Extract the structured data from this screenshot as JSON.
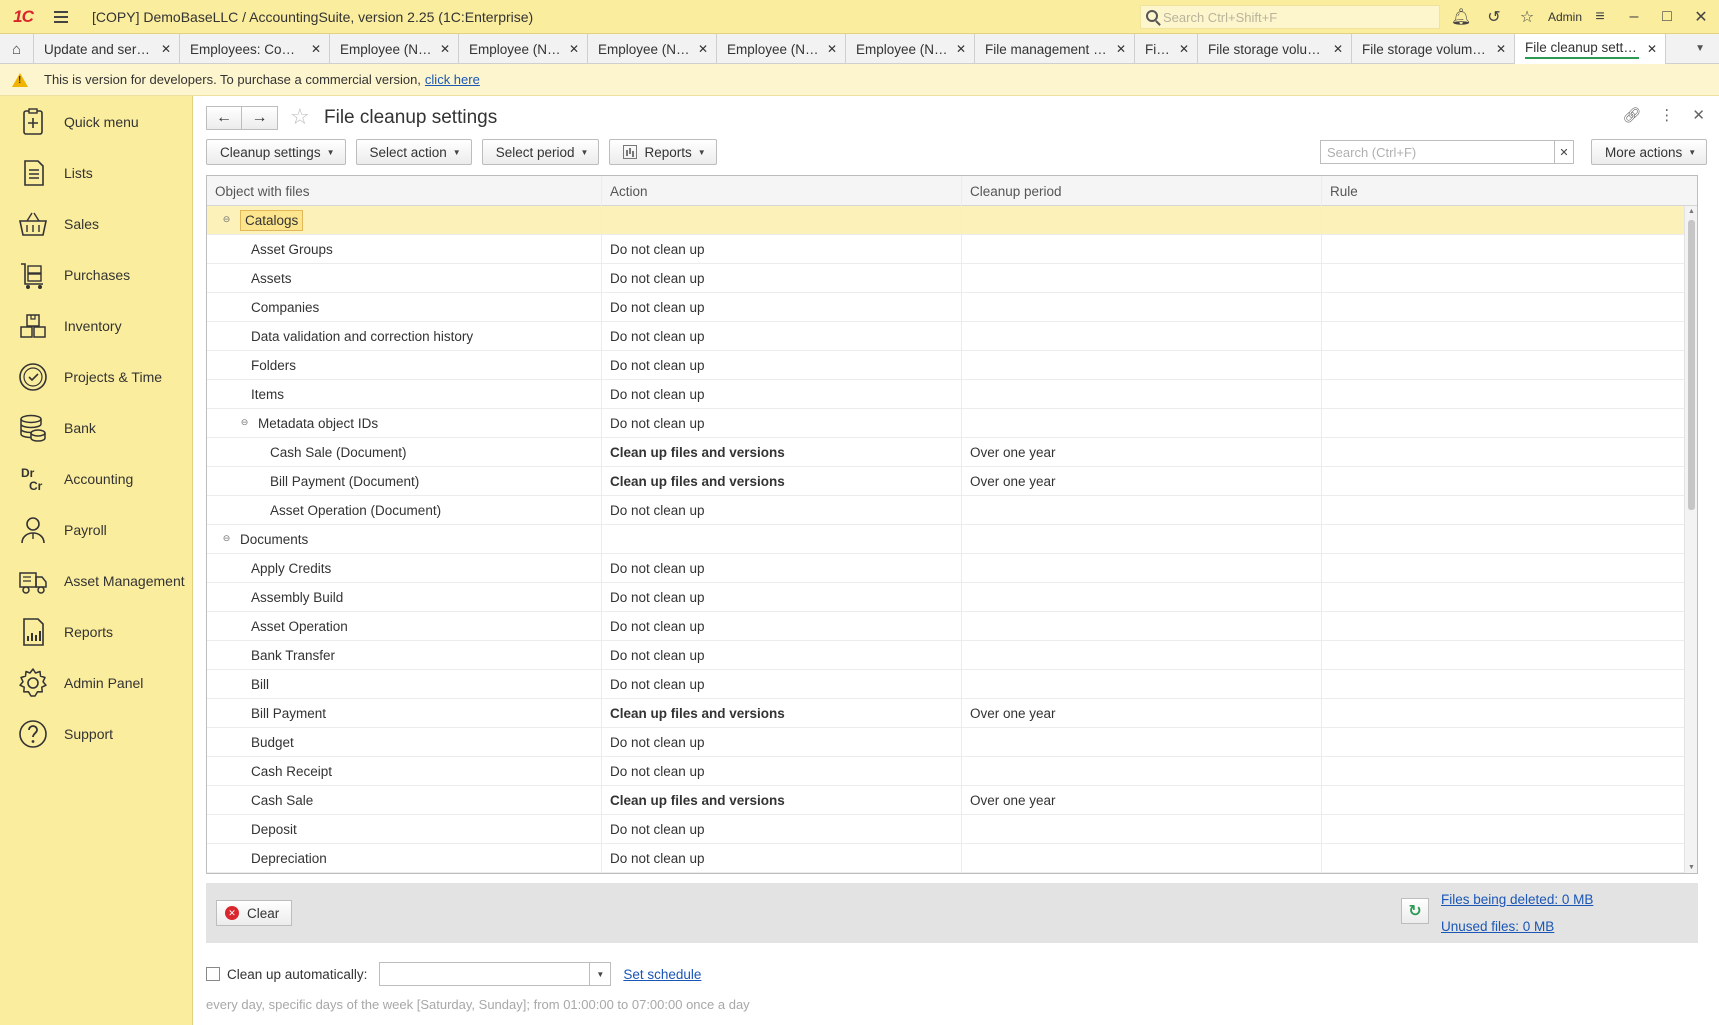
{
  "window": {
    "logo": "1C",
    "title": "[COPY] DemoBaseLLC / AccountingSuite, version 2.25  (1C:Enterprise)",
    "search_placeholder": "Search Ctrl+Shift+F",
    "user": "Admin"
  },
  "tabs": [
    {
      "label": "Update and service",
      "active": false
    },
    {
      "label": "Employees: Compa...",
      "active": false
    },
    {
      "label": "Employee (New)",
      "active": false
    },
    {
      "label": "Employee (New)",
      "active": false
    },
    {
      "label": "Employee (New)",
      "active": false
    },
    {
      "label": "Employee (New)",
      "active": false
    },
    {
      "label": "Employee (New)",
      "active": false
    },
    {
      "label": "File management s...",
      "active": false
    },
    {
      "label": "Files",
      "active": false
    },
    {
      "label": "File storage volumes",
      "active": false
    },
    {
      "label": "File storage volume ...",
      "active": false
    },
    {
      "label": "File cleanup settings",
      "active": true
    }
  ],
  "dev_banner": {
    "text": "This is version for developers. To purchase a commercial version,",
    "link": "click here"
  },
  "sidebar": {
    "items": [
      {
        "label": "Quick menu",
        "icon": "quick-menu-icon"
      },
      {
        "label": "Lists",
        "icon": "lists-icon"
      },
      {
        "label": "Sales",
        "icon": "basket-icon"
      },
      {
        "label": "Purchases",
        "icon": "cart-icon"
      },
      {
        "label": "Inventory",
        "icon": "boxes-icon"
      },
      {
        "label": "Projects & Time",
        "icon": "clock-check-icon"
      },
      {
        "label": "Bank",
        "icon": "coins-icon"
      },
      {
        "label": "Accounting",
        "icon": "dr-cr-icon"
      },
      {
        "label": "Payroll",
        "icon": "person-icon"
      },
      {
        "label": "Asset Management",
        "icon": "truck-icon"
      },
      {
        "label": "Reports",
        "icon": "report-icon"
      },
      {
        "label": "Admin Panel",
        "icon": "gear-icon"
      },
      {
        "label": "Support",
        "icon": "question-icon"
      }
    ]
  },
  "form": {
    "title": "File cleanup settings",
    "commands": {
      "cleanup_settings": "Cleanup settings",
      "select_action": "Select action",
      "select_period": "Select period",
      "reports": "Reports",
      "more_actions": "More actions"
    },
    "search_placeholder": "Search (Ctrl+F)",
    "columns": [
      "Object with files",
      "Action",
      "Cleanup period",
      "Rule"
    ],
    "rows": [
      {
        "object": "Catalogs",
        "action": "",
        "period": "",
        "rule": "",
        "level": 0,
        "group": true,
        "selected": true,
        "bold": false
      },
      {
        "object": "Asset Groups",
        "action": "Do not clean up",
        "period": "",
        "rule": "",
        "level": 1,
        "group": false,
        "selected": false,
        "bold": false
      },
      {
        "object": "Assets",
        "action": "Do not clean up",
        "period": "",
        "rule": "",
        "level": 1,
        "group": false,
        "selected": false,
        "bold": false
      },
      {
        "object": "Companies",
        "action": "Do not clean up",
        "period": "",
        "rule": "",
        "level": 1,
        "group": false,
        "selected": false,
        "bold": false
      },
      {
        "object": "Data validation and correction history",
        "action": "Do not clean up",
        "period": "",
        "rule": "",
        "level": 1,
        "group": false,
        "selected": false,
        "bold": false
      },
      {
        "object": "Folders",
        "action": "Do not clean up",
        "period": "",
        "rule": "",
        "level": 1,
        "group": false,
        "selected": false,
        "bold": false
      },
      {
        "object": "Items",
        "action": "Do not clean up",
        "period": "",
        "rule": "",
        "level": 1,
        "group": false,
        "selected": false,
        "bold": false
      },
      {
        "object": "Metadata object IDs",
        "action": "Do not clean up",
        "period": "",
        "rule": "",
        "level": 1,
        "group": true,
        "selected": false,
        "bold": false
      },
      {
        "object": "Cash Sale (Document)",
        "action": "Clean up files and versions",
        "period": "Over one year",
        "rule": "",
        "level": 2,
        "group": false,
        "selected": false,
        "bold": true
      },
      {
        "object": "Bill Payment (Document)",
        "action": "Clean up files and versions",
        "period": "Over one year",
        "rule": "",
        "level": 2,
        "group": false,
        "selected": false,
        "bold": true
      },
      {
        "object": "Asset Operation (Document)",
        "action": "Do not clean up",
        "period": "",
        "rule": "",
        "level": 2,
        "group": false,
        "selected": false,
        "bold": false
      },
      {
        "object": "Documents",
        "action": "",
        "period": "",
        "rule": "",
        "level": 0,
        "group": true,
        "selected": false,
        "bold": false
      },
      {
        "object": "Apply Credits",
        "action": "Do not clean up",
        "period": "",
        "rule": "",
        "level": 1,
        "group": false,
        "selected": false,
        "bold": false
      },
      {
        "object": "Assembly Build",
        "action": "Do not clean up",
        "period": "",
        "rule": "",
        "level": 1,
        "group": false,
        "selected": false,
        "bold": false
      },
      {
        "object": "Asset Operation",
        "action": "Do not clean up",
        "period": "",
        "rule": "",
        "level": 1,
        "group": false,
        "selected": false,
        "bold": false
      },
      {
        "object": "Bank Transfer",
        "action": "Do not clean up",
        "period": "",
        "rule": "",
        "level": 1,
        "group": false,
        "selected": false,
        "bold": false
      },
      {
        "object": "Bill",
        "action": "Do not clean up",
        "period": "",
        "rule": "",
        "level": 1,
        "group": false,
        "selected": false,
        "bold": false
      },
      {
        "object": "Bill Payment",
        "action": "Clean up files and versions",
        "period": "Over one year",
        "rule": "",
        "level": 1,
        "group": false,
        "selected": false,
        "bold": true
      },
      {
        "object": "Budget",
        "action": "Do not clean up",
        "period": "",
        "rule": "",
        "level": 1,
        "group": false,
        "selected": false,
        "bold": false
      },
      {
        "object": "Cash Receipt",
        "action": "Do not clean up",
        "period": "",
        "rule": "",
        "level": 1,
        "group": false,
        "selected": false,
        "bold": false
      },
      {
        "object": "Cash Sale",
        "action": "Clean up files and versions",
        "period": "Over one year",
        "rule": "",
        "level": 1,
        "group": false,
        "selected": false,
        "bold": true
      },
      {
        "object": "Deposit",
        "action": "Do not clean up",
        "period": "",
        "rule": "",
        "level": 1,
        "group": false,
        "selected": false,
        "bold": false
      },
      {
        "object": "Depreciation",
        "action": "Do not clean up",
        "period": "",
        "rule": "",
        "level": 1,
        "group": false,
        "selected": false,
        "bold": false
      }
    ],
    "footer": {
      "clear": "Clear",
      "files_being_deleted": "Files being deleted: 0 MB",
      "unused_files": "Unused files: 0 MB"
    },
    "auto_cleanup": {
      "label": "Clean up automatically:",
      "checked": false,
      "value": "",
      "set_schedule": "Set schedule",
      "schedule_description": "every day, specific days of the week [Saturday, Sunday]; from 01:00:00 to 07:00:00 once a day"
    }
  }
}
